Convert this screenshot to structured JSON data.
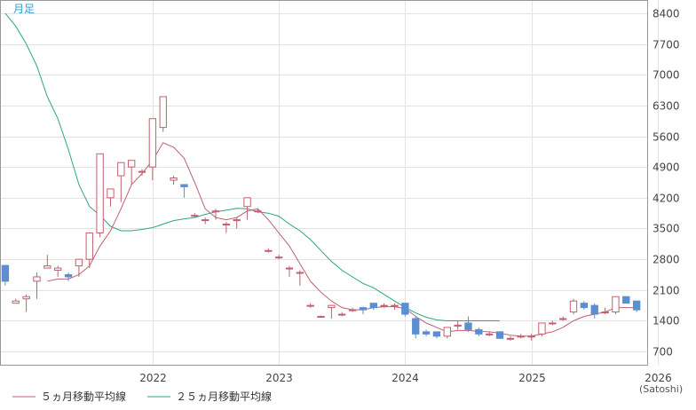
{
  "period_label": "月足",
  "unit_label": "(Satoshi)",
  "legend": [
    {
      "label": "５ヵ月移動平均線",
      "color": "#c06070"
    },
    {
      "label": "２５ヵ月移動平均線",
      "color": "#2aa87a"
    }
  ],
  "colors": {
    "up": "#c06070",
    "down": "#5b8fd0",
    "ma5": "#c06070",
    "ma25": "#2aa87a",
    "grid": "#e3e3e3",
    "border": "#999999"
  },
  "chart_data": {
    "type": "candlestick",
    "x_ticks": [
      "2022",
      "2023",
      "2024",
      "2025",
      "2026"
    ],
    "x_tick_months": [
      14,
      26,
      38,
      50,
      62
    ],
    "y_ticks": [
      700,
      1400,
      2100,
      2800,
      3500,
      4200,
      4900,
      5600,
      6300,
      7000,
      7700,
      8400
    ],
    "ylim": [
      400,
      8700
    ],
    "xlim": [
      0,
      61.5
    ],
    "candles": [
      [
        2660,
        2660,
        2200,
        2300
      ],
      [
        1800,
        1900,
        1800,
        1850
      ],
      [
        1900,
        2000,
        1600,
        1950
      ],
      [
        2300,
        2500,
        1900,
        2400
      ],
      [
        2600,
        2900,
        2600,
        2650
      ],
      [
        2550,
        2650,
        2400,
        2600
      ],
      [
        2450,
        2500,
        2300,
        2400
      ],
      [
        2650,
        2800,
        2400,
        2800
      ],
      [
        2800,
        3400,
        2600,
        3400
      ],
      [
        3400,
        5200,
        3300,
        5200
      ],
      [
        4200,
        4400,
        4000,
        4400
      ],
      [
        4700,
        5000,
        4100,
        5000
      ],
      [
        4900,
        5050,
        4500,
        5050
      ],
      [
        4800,
        4850,
        4700,
        4800
      ],
      [
        4900,
        6000,
        4600,
        6000
      ],
      [
        5800,
        6500,
        5700,
        6500
      ],
      [
        4600,
        4700,
        4500,
        4650
      ],
      [
        4500,
        4500,
        4200,
        4450
      ],
      [
        3800,
        3850,
        3750,
        3800
      ],
      [
        3700,
        3750,
        3600,
        3700
      ],
      [
        3900,
        3950,
        3700,
        3900
      ],
      [
        3600,
        3650,
        3400,
        3600
      ],
      [
        3700,
        3750,
        3500,
        3700
      ],
      [
        4000,
        4200,
        3700,
        4200
      ],
      [
        3900,
        3950,
        3850,
        3900
      ],
      [
        3000,
        3050,
        2950,
        3000
      ],
      [
        2850,
        2900,
        2800,
        2850
      ],
      [
        2600,
        2650,
        2400,
        2600
      ],
      [
        2500,
        2550,
        2200,
        2500
      ],
      [
        1750,
        1800,
        1700,
        1750
      ],
      [
        1500,
        1520,
        1480,
        1500
      ],
      [
        1700,
        1750,
        1450,
        1750
      ],
      [
        1550,
        1600,
        1500,
        1550
      ],
      [
        1650,
        1700,
        1600,
        1650
      ],
      [
        1700,
        1720,
        1550,
        1650
      ],
      [
        1800,
        1800,
        1650,
        1700
      ],
      [
        1750,
        1800,
        1700,
        1750
      ],
      [
        1750,
        1800,
        1650,
        1750
      ],
      [
        1800,
        1800,
        1500,
        1550
      ],
      [
        1450,
        1500,
        1000,
        1100
      ],
      [
        1150,
        1200,
        1050,
        1100
      ],
      [
        1150,
        1150,
        1000,
        1050
      ],
      [
        1050,
        1250,
        1000,
        1250
      ],
      [
        1300,
        1400,
        1200,
        1300
      ],
      [
        1350,
        1500,
        1150,
        1200
      ],
      [
        1200,
        1250,
        1050,
        1100
      ],
      [
        1100,
        1150,
        1050,
        1100
      ],
      [
        1150,
        1150,
        1000,
        1000
      ],
      [
        1000,
        1050,
        950,
        1000
      ],
      [
        1050,
        1100,
        1000,
        1050
      ],
      [
        1050,
        1100,
        950,
        1050
      ],
      [
        1100,
        1350,
        1050,
        1350
      ],
      [
        1350,
        1400,
        1300,
        1350
      ],
      [
        1450,
        1500,
        1400,
        1450
      ],
      [
        1600,
        1900,
        1550,
        1850
      ],
      [
        1800,
        1850,
        1650,
        1700
      ],
      [
        1750,
        1800,
        1450,
        1550
      ],
      [
        1600,
        1700,
        1550,
        1600
      ],
      [
        1600,
        1950,
        1550,
        1950
      ],
      [
        1950,
        1950,
        1800,
        1800
      ],
      [
        1850,
        1850,
        1600,
        1650
      ]
    ],
    "ma5": [
      null,
      null,
      null,
      null,
      2300,
      2350,
      2350,
      2450,
      2650,
      3100,
      3450,
      3950,
      4500,
      4750,
      5050,
      5450,
      5350,
      5100,
      4550,
      3950,
      3750,
      3700,
      3750,
      3900,
      3950,
      3700,
      3400,
      3100,
      2700,
      2300,
      2050,
      1850,
      1700,
      1650,
      1650,
      1700,
      1720,
      1720,
      1680,
      1500,
      1350,
      1250,
      1150,
      1180,
      1180,
      1160,
      1150,
      1120,
      1070,
      1050,
      1050,
      1100,
      1150,
      1250,
      1400,
      1500,
      1550,
      1600,
      1700,
      1700,
      1700
    ],
    "ma25": [
      8400,
      8100,
      7700,
      7200,
      6500,
      6000,
      5300,
      4500,
      4000,
      3800,
      3550,
      3450,
      3450,
      3480,
      3520,
      3600,
      3680,
      3720,
      3750,
      3820,
      3880,
      3920,
      3960,
      3950,
      3880,
      3850,
      3780,
      3600,
      3450,
      3250,
      3000,
      2750,
      2550,
      2400,
      2250,
      2150,
      2000,
      1850,
      1700,
      1580,
      1480,
      1420,
      1400,
      1400,
      1400,
      1400,
      1400,
      1400
    ]
  }
}
